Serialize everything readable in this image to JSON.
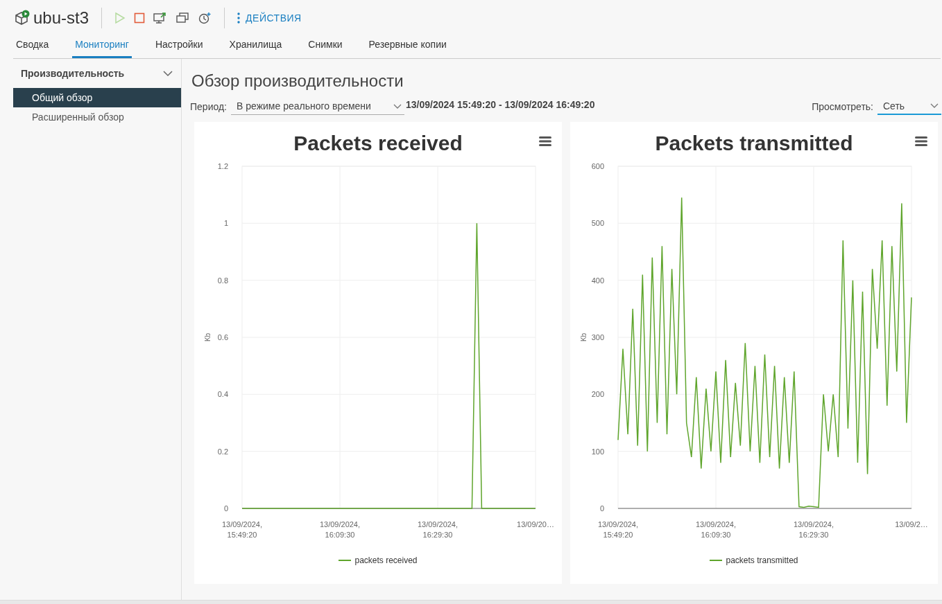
{
  "header": {
    "title": "ubu-st3",
    "actions_label": "ДЕЙСТВИЯ"
  },
  "tabs": [
    {
      "label": "Сводка",
      "selected": false
    },
    {
      "label": "Мониторинг",
      "selected": true
    },
    {
      "label": "Настройки",
      "selected": false
    },
    {
      "label": "Хранилища",
      "selected": false
    },
    {
      "label": "Снимки",
      "selected": false
    },
    {
      "label": "Резервные копии",
      "selected": false
    }
  ],
  "sidebar": {
    "section": {
      "label": "Производительность",
      "expanded": true
    },
    "items": [
      {
        "label": "Общий обзор",
        "selected": true
      },
      {
        "label": "Расширенный обзор",
        "selected": false
      }
    ]
  },
  "main": {
    "title": "Обзор производительности",
    "period_label": "Период:",
    "period_value": "В режиме реального времени",
    "range": "13/09/2024 15:49:20 - 13/09/2024 16:49:20",
    "view_label": "Просмотреть:",
    "view_value": "Сеть"
  },
  "charts": [
    {
      "chart_data": {
        "type": "line",
        "title": "Packets received",
        "ylabel": "Kb",
        "categories": [
          "13/09/2024, 15:49:20",
          null,
          null,
          null,
          null,
          null,
          null,
          null,
          null,
          null,
          null,
          null,
          null,
          null,
          null,
          null,
          null,
          null,
          null,
          null,
          "13/09/2024, 16:09:30",
          null,
          null,
          null,
          null,
          null,
          null,
          null,
          null,
          null,
          null,
          null,
          null,
          null,
          null,
          null,
          null,
          null,
          null,
          null,
          "13/09/2024, 16:29:30",
          null,
          null,
          null,
          null,
          null,
          null,
          null,
          null,
          null,
          null,
          null,
          null,
          null,
          null,
          null,
          null,
          null,
          null,
          null,
          "13/09/20…"
        ],
        "series": [
          {
            "name": "packets received",
            "color": "#5fa52c",
            "values": [
              0,
              0,
              0,
              0,
              0,
              0,
              0,
              0,
              0,
              0,
              0,
              0,
              0,
              0,
              0,
              0,
              0,
              0,
              0,
              0,
              0,
              0,
              0,
              0,
              0,
              0,
              0,
              0,
              0,
              0,
              0,
              0,
              0,
              0,
              0,
              0,
              0,
              0,
              0,
              0,
              0,
              0,
              0,
              0,
              0,
              0,
              0,
              0,
              1,
              0,
              0,
              0,
              0,
              0,
              0,
              0,
              0,
              0,
              0,
              0,
              0
            ]
          }
        ],
        "grid": true,
        "ylim": [
          0,
          1.2
        ],
        "yticks": [
          0,
          {
            "value": 0.2,
            "label": "0.2"
          },
          {
            "value": 0.4,
            "label": "0.4"
          },
          {
            "value": 0.6,
            "label": "0.6"
          },
          {
            "value": 0.8,
            "label": "0.8"
          },
          1,
          {
            "value": 1.2,
            "label": "1.2"
          }
        ]
      }
    },
    {
      "chart_data": {
        "type": "line",
        "title": "Packets transmitted",
        "ylabel": "Kb",
        "categories": [
          "13/09/2024, 15:49:20",
          null,
          null,
          null,
          null,
          null,
          null,
          null,
          null,
          null,
          null,
          null,
          null,
          null,
          null,
          null,
          null,
          null,
          null,
          null,
          "13/09/2024, 16:09:30",
          null,
          null,
          null,
          null,
          null,
          null,
          null,
          null,
          null,
          null,
          null,
          null,
          null,
          null,
          null,
          null,
          null,
          null,
          null,
          "13/09/2024, 16:29:30",
          null,
          null,
          null,
          null,
          null,
          null,
          null,
          null,
          null,
          null,
          null,
          null,
          null,
          null,
          null,
          null,
          null,
          null,
          null,
          "13/09/2…"
        ],
        "series": [
          {
            "name": "packets transmitted",
            "color": "#5fa52c",
            "values": [
              120,
              280,
              130,
              350,
              110,
              410,
              100,
              440,
              150,
              460,
              130,
              420,
              200,
              545,
              150,
              90,
              230,
              70,
              210,
              100,
              240,
              80,
              260,
              90,
              220,
              110,
              290,
              100,
              250,
              80,
              270,
              90,
              250,
              70,
              230,
              80,
              240,
              3,
              2,
              4,
              3,
              2,
              200,
              100,
              200,
              90,
              470,
              140,
              400,
              80,
              380,
              60,
              420,
              280,
              470,
              180,
              460,
              240,
              535,
              150,
              370
            ]
          }
        ],
        "grid": true,
        "ylim": [
          0,
          600
        ],
        "yticks": [
          0,
          100,
          200,
          300,
          400,
          500,
          600
        ]
      }
    }
  ]
}
